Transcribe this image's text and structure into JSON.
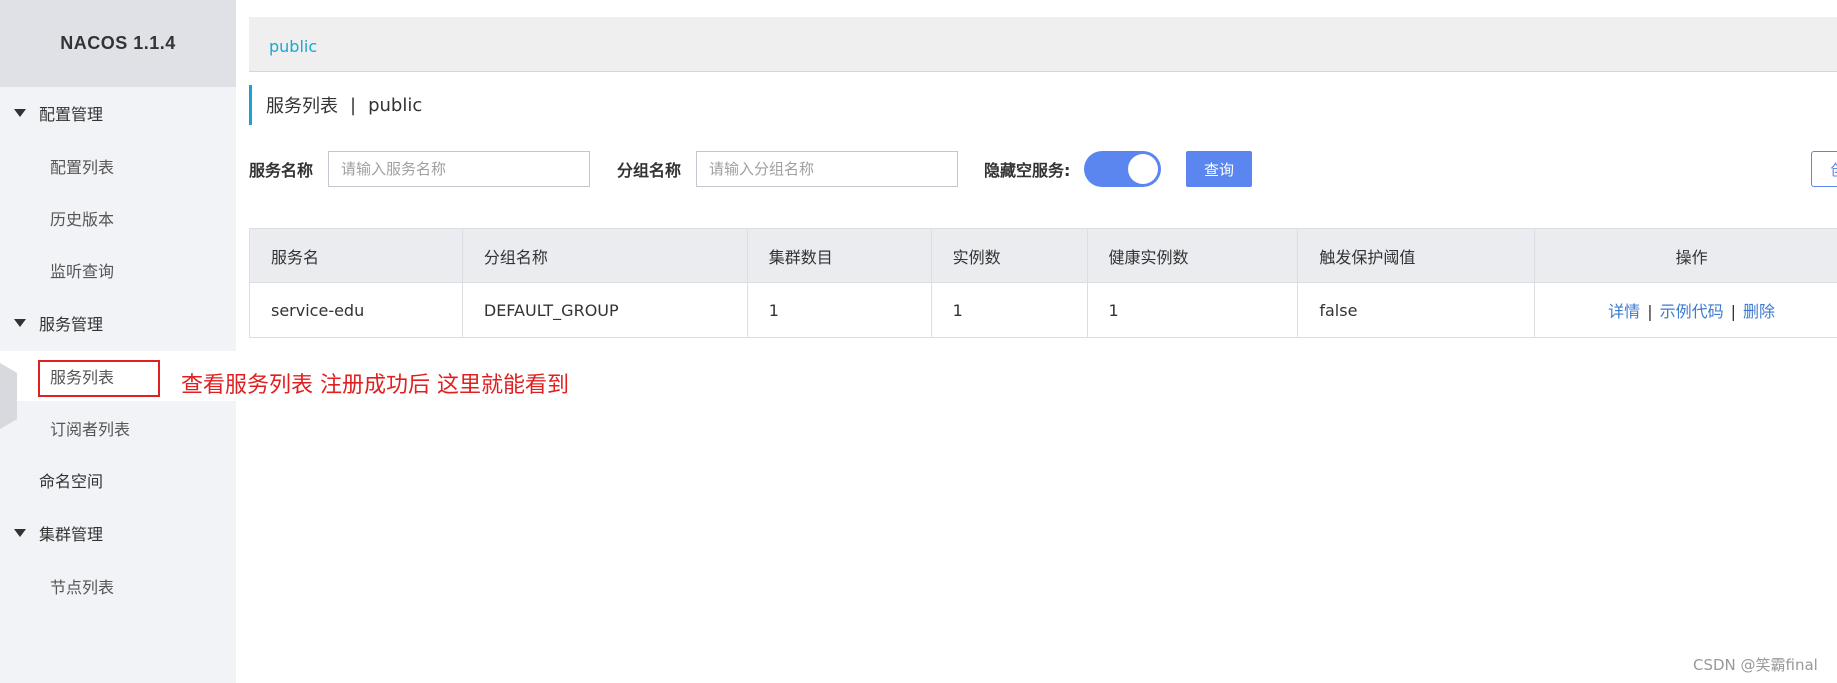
{
  "brand": "NACOS 1.1.4",
  "sidebar": {
    "config_group": "配置管理",
    "config_list": "配置列表",
    "history": "历史版本",
    "listener": "监听查询",
    "service_group": "服务管理",
    "service_list": "服务列表",
    "subscriber_list": "订阅者列表",
    "namespace": "命名空间",
    "cluster_group": "集群管理",
    "node_list": "节点列表"
  },
  "topbar": {
    "namespace": "public"
  },
  "title": {
    "main": "服务列表",
    "sep": "|",
    "namespace": "public"
  },
  "filters": {
    "service_name_label": "服务名称",
    "service_name_placeholder": "请输入服务名称",
    "group_name_label": "分组名称",
    "group_name_placeholder": "请输入分组名称",
    "hide_empty_label": "隐藏空服务:",
    "hide_empty_on": true,
    "query_button": "查询",
    "create_button": "创"
  },
  "table": {
    "headers": [
      "服务名",
      "分组名称",
      "集群数目",
      "实例数",
      "健康实例数",
      "触发保护阈值",
      "操作"
    ],
    "rows": [
      {
        "name": "service-edu",
        "group": "DEFAULT_GROUP",
        "clusters": "1",
        "instances": "1",
        "healthy": "1",
        "threshold": "false"
      }
    ],
    "actions": {
      "detail": "详情",
      "sample": "示例代码",
      "delete": "删除",
      "sep": "|"
    }
  },
  "annotation": "查看服务列表   注册成功后 这里就能看到",
  "watermark": "CSDN @笑霸final",
  "colors": {
    "accent": "#5b86f0",
    "link": "#3c7ad0",
    "annotation": "#e02020",
    "namespace_link": "#1aa7d4"
  }
}
